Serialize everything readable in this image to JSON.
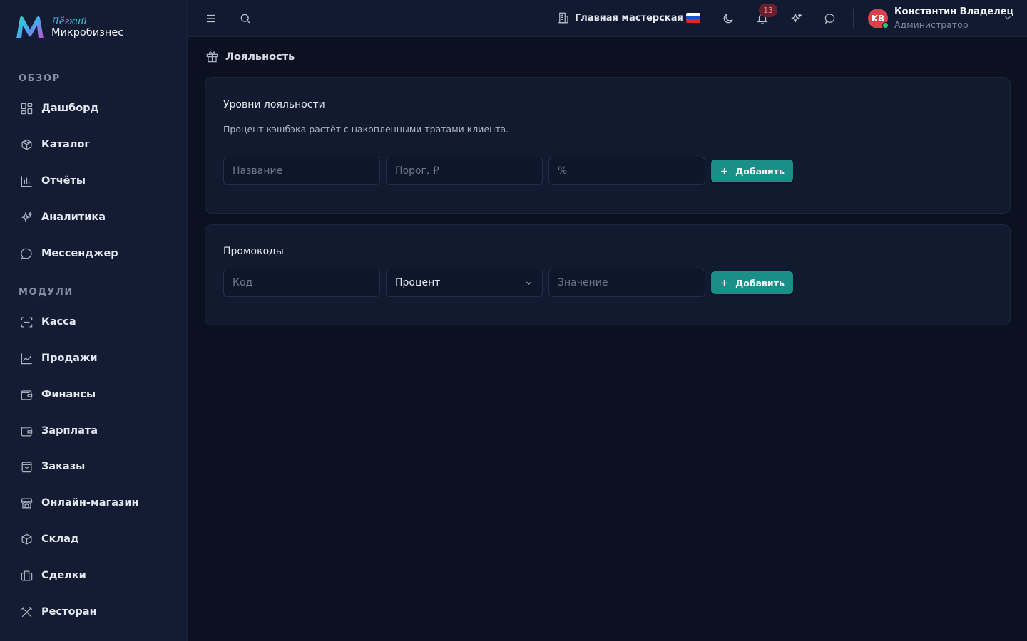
{
  "logo": {
    "top": "Лёгкий",
    "bottom": "Микробизнес"
  },
  "sidebar": {
    "section_overview": "ОБЗОР",
    "section_modules": "МОДУЛИ",
    "overview_items": [
      {
        "label": "Дашборд",
        "icon": "dashboard-icon"
      },
      {
        "label": "Каталог",
        "icon": "catalog-icon"
      },
      {
        "label": "Отчёты",
        "icon": "reports-icon"
      },
      {
        "label": "Аналитика",
        "icon": "sparkles-icon"
      },
      {
        "label": "Мессенджер",
        "icon": "chat-icon"
      }
    ],
    "module_items": [
      {
        "label": "Касса",
        "icon": "scan-icon"
      },
      {
        "label": "Продажи",
        "icon": "line-chart-icon"
      },
      {
        "label": "Финансы",
        "icon": "wallet-icon"
      },
      {
        "label": "Зарплата",
        "icon": "wallet-icon"
      },
      {
        "label": "Заказы",
        "icon": "bag-icon"
      },
      {
        "label": "Онлайн-магазин",
        "icon": "store-icon"
      },
      {
        "label": "Склад",
        "icon": "box-icon"
      },
      {
        "label": "Сделки",
        "icon": "briefcase-icon"
      },
      {
        "label": "Ресторан",
        "icon": "utensils-icon"
      }
    ]
  },
  "topbar": {
    "workshop": "Главная мастерская",
    "notifications_count": "13",
    "user": {
      "initials": "KB",
      "name": "Константин Владелец",
      "role": "Администратор"
    }
  },
  "page": {
    "title": "Лояльность"
  },
  "loyalty": {
    "title": "Уровни лояльности",
    "subtitle": "Процент кэшбэка растёт с накопленными тратами клиента.",
    "name_placeholder": "Название",
    "threshold_placeholder": "Порог, ₽",
    "percent_placeholder": "%",
    "add_label": "Добавить"
  },
  "promo": {
    "title": "Промокоды",
    "code_placeholder": "Код",
    "type_value": "Процент",
    "value_placeholder": "Значение",
    "add_label": "Добавить"
  },
  "colors": {
    "accent": "#1a8f87",
    "background": "#0b1120",
    "sidebar": "#141c33"
  }
}
